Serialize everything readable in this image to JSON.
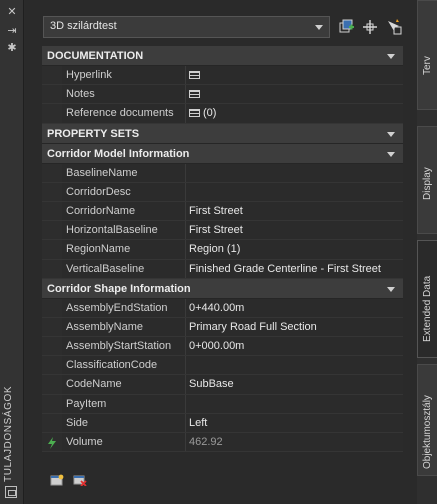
{
  "palette_title": "TULAJDONSÁGOK",
  "selector": {
    "value": "3D szilárdtest"
  },
  "categories": {
    "documentation": "DOCUMENTATION",
    "property_sets": "PROPERTY SETS",
    "corridor_model": "Corridor Model Information",
    "corridor_shape": "Corridor Shape Information"
  },
  "documentation_rows": [
    {
      "name": "Hyperlink",
      "value": ""
    },
    {
      "name": "Notes",
      "value": ""
    },
    {
      "name": "Reference documents",
      "value": "(0)"
    }
  ],
  "corridor_model_rows": [
    {
      "name": "BaselineName",
      "value": ""
    },
    {
      "name": "CorridorDesc",
      "value": ""
    },
    {
      "name": "CorridorName",
      "value": "First Street"
    },
    {
      "name": "HorizontalBaseline",
      "value": "First Street"
    },
    {
      "name": "RegionName",
      "value": "Region (1)"
    },
    {
      "name": "VerticalBaseline",
      "value": "Finished Grade Centerline - First Street"
    }
  ],
  "corridor_shape_rows": [
    {
      "name": "AssemblyEndStation",
      "value": "0+440.00m"
    },
    {
      "name": "AssemblyName",
      "value": "Primary Road Full Section"
    },
    {
      "name": "AssemblyStartStation",
      "value": "0+000.00m"
    },
    {
      "name": "ClassificationCode",
      "value": ""
    },
    {
      "name": "CodeName",
      "value": "SubBase"
    },
    {
      "name": "PayItem",
      "value": ""
    },
    {
      "name": "Side",
      "value": "Left"
    },
    {
      "name": "Volume",
      "value": "462.92"
    }
  ],
  "tabs": [
    "Terv",
    "Display",
    "Extended Data",
    "Objektumosztály"
  ],
  "icons": {
    "toolbar": [
      "quick-select-icon",
      "select-objects-icon",
      "pickadd-toggle-icon"
    ],
    "left": [
      "close-icon",
      "autohide-icon",
      "properties-icon"
    ],
    "bottom": [
      "add-property-set-icon",
      "remove-property-set-icon"
    ]
  },
  "colors": {
    "background": "#2a2a2a",
    "category": "#3d3d3d",
    "accent": "#4caf50"
  }
}
